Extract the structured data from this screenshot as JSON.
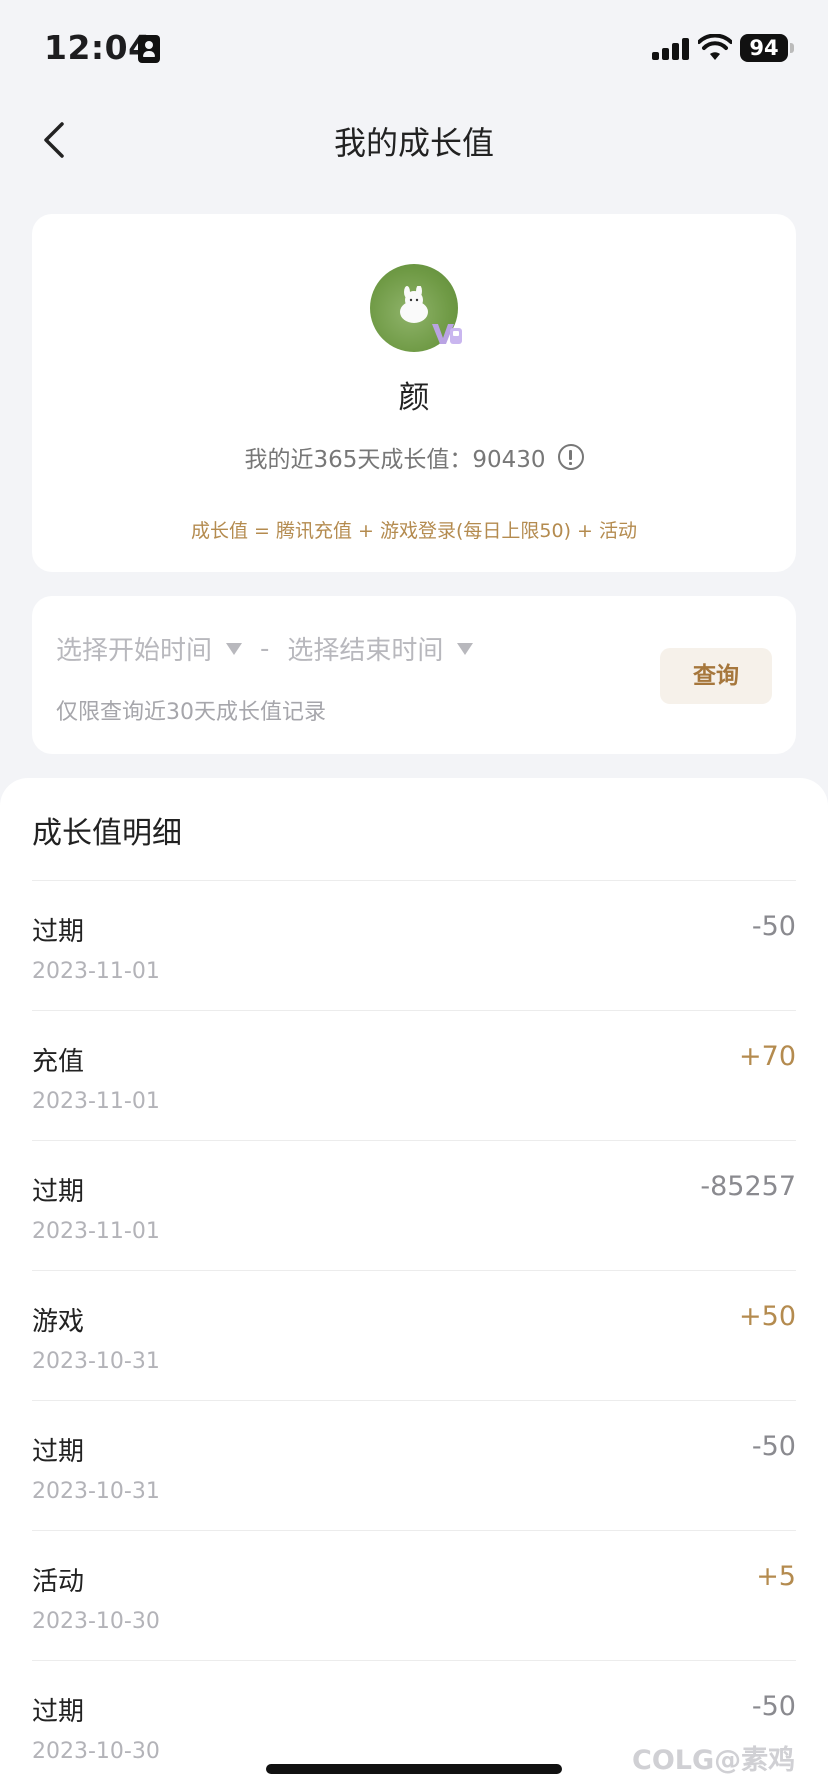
{
  "status_bar": {
    "time": "12:04",
    "battery": "94"
  },
  "nav": {
    "title": "我的成长值"
  },
  "profile": {
    "name": "颜",
    "summary_label": "我的近365天成长值：",
    "summary_value": "90430",
    "formula": "成长值 = 腾讯充值 + 游戏登录(每日上限50) + 活动"
  },
  "query": {
    "start_placeholder": "选择开始时间",
    "separator": "-",
    "end_placeholder": "选择结束时间",
    "hint": "仅限查询近30天成长值记录",
    "button": "查询"
  },
  "detail": {
    "title": "成长值明细",
    "items": [
      {
        "type": "过期",
        "date": "2023-11-01",
        "value": "-50"
      },
      {
        "type": "充值",
        "date": "2023-11-01",
        "value": "+70"
      },
      {
        "type": "过期",
        "date": "2023-11-01",
        "value": "-85257"
      },
      {
        "type": "游戏",
        "date": "2023-10-31",
        "value": "+50"
      },
      {
        "type": "过期",
        "date": "2023-10-31",
        "value": "-50"
      },
      {
        "type": "活动",
        "date": "2023-10-30",
        "value": "+5"
      },
      {
        "type": "过期",
        "date": "2023-10-30",
        "value": "-50"
      }
    ]
  },
  "watermark": "COLG@素鸡",
  "colors": {
    "accent": "#b48b4f",
    "background": "#f3f4f7",
    "negative": "#8a8a8f"
  }
}
